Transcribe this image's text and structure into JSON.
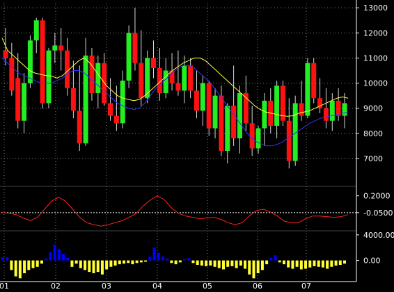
{
  "chart_data": [
    {
      "type": "candlestick",
      "panel": "price",
      "x": [
        "01",
        "02",
        "03",
        "04",
        "05",
        "06",
        "07"
      ],
      "ylim": [
        6000,
        13200
      ],
      "y_ticks": [
        "13000",
        "12000",
        "11000",
        "10000",
        "9000",
        "8000",
        "7000"
      ],
      "ma_long": [
        11800,
        11300,
        11100,
        10900,
        10700,
        10500,
        10400,
        10350,
        10300,
        10280,
        10200,
        10300,
        10500,
        10700,
        10900,
        11000,
        10800,
        10500,
        10200,
        9900,
        9700,
        9500,
        9400,
        9350,
        9300,
        9350,
        9500,
        9700,
        9900,
        10100,
        10300,
        10500,
        10650,
        10800,
        10900,
        11000,
        11000,
        10900,
        10700,
        10500,
        10300,
        10100,
        9900,
        9700,
        9500,
        9300,
        9100,
        8950,
        8850,
        8800,
        8750,
        8700,
        8680,
        8700,
        8800,
        8850,
        8900,
        9000,
        9100,
        9200,
        9300,
        9400,
        9450,
        9400
      ],
      "ma_short": [
        11000,
        10800,
        10600,
        10400,
        10300,
        10200,
        10100,
        10000,
        10000,
        10000,
        10100,
        10200,
        10400,
        10500,
        10500,
        10400,
        10200,
        10000,
        9800,
        9600,
        9400,
        9200,
        9100,
        9000,
        8950,
        9000,
        9200,
        9500,
        9800,
        10000,
        10200,
        10400,
        10600,
        10700,
        10700,
        10600,
        10400,
        10200,
        10000,
        9700,
        9400,
        9100,
        8800,
        8500,
        8200,
        7900,
        7700,
        7600,
        7500,
        7500,
        7550,
        7650,
        7800,
        7950,
        8100,
        8250,
        8400,
        8500,
        8600,
        8650,
        8700,
        8750,
        8800,
        8850
      ],
      "candles": [
        [
          11300,
          12200,
          10700,
          11000
        ],
        [
          11000,
          11600,
          9500,
          9700
        ],
        [
          10200,
          11200,
          8200,
          8500
        ],
        [
          8500,
          10400,
          8000,
          10000
        ],
        [
          10000,
          11900,
          9800,
          11700
        ],
        [
          11700,
          12600,
          11200,
          12500
        ],
        [
          12500,
          12600,
          9000,
          9200
        ],
        [
          9200,
          11400,
          9000,
          11300
        ],
        [
          11300,
          12000,
          10800,
          11500
        ],
        [
          11500,
          12200,
          10500,
          11300
        ],
        [
          11300,
          11800,
          9500,
          9800
        ],
        [
          9800,
          10900,
          8600,
          8900
        ],
        [
          8900,
          10700,
          7300,
          7600
        ],
        [
          7600,
          11800,
          7500,
          11100
        ],
        [
          11100,
          11400,
          9300,
          9600
        ],
        [
          9600,
          11100,
          9000,
          10800
        ],
        [
          10800,
          11200,
          9100,
          9200
        ],
        [
          9200,
          10200,
          8500,
          8700
        ],
        [
          8700,
          9900,
          8100,
          8400
        ],
        [
          8400,
          10500,
          8200,
          10100
        ],
        [
          10100,
          12300,
          9800,
          12000
        ],
        [
          12000,
          13000,
          10500,
          10800
        ],
        [
          10800,
          12100,
          9100,
          9400
        ],
        [
          9400,
          11300,
          9200,
          11000
        ],
        [
          11000,
          11700,
          10200,
          10600
        ],
        [
          10600,
          11400,
          9300,
          9600
        ],
        [
          9600,
          11000,
          9400,
          10500
        ],
        [
          10500,
          11200,
          9700,
          10000
        ],
        [
          10000,
          11300,
          9500,
          9700
        ],
        [
          9700,
          11100,
          9200,
          10700
        ],
        [
          10700,
          11000,
          9400,
          9700
        ],
        [
          9700,
          10500,
          8600,
          8900
        ],
        [
          8900,
          10300,
          8300,
          10000
        ],
        [
          10000,
          10100,
          7900,
          8200
        ],
        [
          8200,
          9800,
          7800,
          9500
        ],
        [
          9500,
          9900,
          7100,
          7300
        ],
        [
          7300,
          9200,
          6800,
          9100
        ],
        [
          9100,
          10700,
          7500,
          7800
        ],
        [
          7800,
          9900,
          7200,
          9600
        ],
        [
          9600,
          10300,
          8100,
          8400
        ],
        [
          8400,
          9100,
          7100,
          7400
        ],
        [
          7400,
          8300,
          7200,
          8200
        ],
        [
          8200,
          9600,
          7500,
          9300
        ],
        [
          9300,
          9800,
          8000,
          8300
        ],
        [
          8300,
          10100,
          7800,
          9900
        ],
        [
          9900,
          10100,
          8300,
          8500
        ],
        [
          8500,
          9400,
          6600,
          6900
        ],
        [
          6900,
          9500,
          6700,
          9200
        ],
        [
          9200,
          10100,
          8500,
          8700
        ],
        [
          8700,
          11000,
          8600,
          10800
        ],
        [
          10800,
          11000,
          9200,
          9400
        ],
        [
          9400,
          10200,
          8800,
          9000
        ],
        [
          9000,
          9800,
          8200,
          8500
        ],
        [
          8500,
          9600,
          8100,
          9300
        ],
        [
          9300,
          9800,
          8500,
          8700
        ],
        [
          8700,
          9600,
          8200,
          9200
        ]
      ]
    },
    {
      "type": "line",
      "panel": "oscillator",
      "y_ticks": [
        "0.2000",
        "-0.0500"
      ],
      "ylim": [
        -0.3,
        0.3
      ],
      "reference_line": -0.05,
      "values": [
        -0.05,
        -0.06,
        -0.08,
        -0.13,
        -0.17,
        -0.12,
        0.0,
        0.12,
        0.18,
        0.12,
        0.0,
        -0.12,
        -0.2,
        -0.23,
        -0.25,
        -0.23,
        -0.2,
        -0.17,
        -0.12,
        -0.06,
        0.05,
        0.14,
        0.2,
        0.14,
        0.02,
        -0.06,
        -0.1,
        -0.12,
        -0.14,
        -0.13,
        -0.12,
        -0.15,
        -0.2,
        -0.23,
        -0.2,
        -0.1,
        -0.02,
        -0.0,
        -0.04,
        -0.1,
        -0.18,
        -0.2,
        -0.2,
        -0.14,
        -0.1,
        -0.1,
        -0.11,
        -0.12,
        -0.11,
        -0.08
      ]
    },
    {
      "type": "bar",
      "panel": "volume-histogram",
      "y_ticks": [
        "4000.00",
        "0.00"
      ],
      "ylim": [
        -3200,
        4200
      ],
      "colors": {
        "positive": "#0000ff",
        "negative": "#ffff33"
      },
      "values": [
        500,
        500,
        -1500,
        -2500,
        -2800,
        -2000,
        -1500,
        -1200,
        -1000,
        -500,
        300,
        1300,
        2500,
        1800,
        1000,
        400,
        -1000,
        -500,
        -1200,
        -1500,
        -1800,
        -2000,
        -1800,
        -2200,
        -1400,
        -1000,
        -800,
        -600,
        -500,
        -400,
        -600,
        -400,
        -300,
        -200,
        600,
        2000,
        1200,
        600,
        300,
        -400,
        -600,
        -300,
        200,
        400,
        -400,
        -700,
        -800,
        -900,
        -800,
        -1000,
        -1200,
        -1400,
        -1000,
        -900,
        -1200,
        -800,
        -1300,
        -2200,
        -2800,
        -2000,
        -1500,
        -600,
        400,
        800,
        -300,
        -600,
        -1100,
        -1300,
        -1000,
        -1400,
        -1300,
        -1100,
        -900,
        -1000,
        -1100,
        -1300,
        -1000,
        -800,
        -700,
        -500
      ]
    }
  ]
}
